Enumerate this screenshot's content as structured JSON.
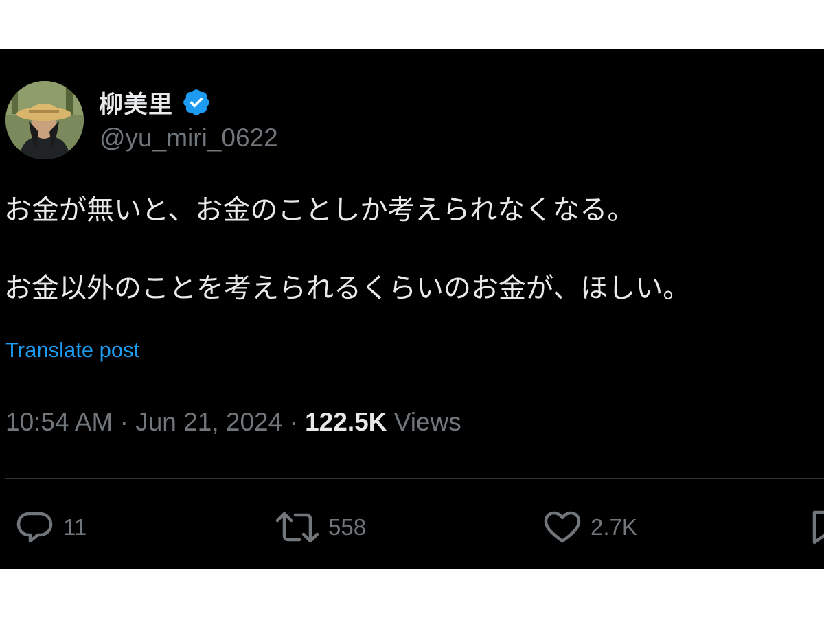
{
  "author": {
    "display_name": "柳美里",
    "handle": "@yu_miri_0622",
    "avatar_icon": "profile-photo-woman-straw-hat",
    "verified_icon": "verified-badge-icon"
  },
  "tweet": {
    "lines": [
      "お金が無いと、お金のことしか考えられなくなる。",
      "お金以外のことを考えられるくらいのお金が、ほしい。"
    ],
    "translate_label": "Translate post"
  },
  "meta": {
    "time": "10:54 AM",
    "separator": " · ",
    "date": "Jun 21, 2024",
    "views_count": "122.5K",
    "views_label": "Views"
  },
  "actions": {
    "replies": "11",
    "reposts": "558",
    "likes": "2.7K"
  },
  "colors": {
    "background": "#000000",
    "text_primary": "#e7e9ea",
    "text_secondary": "#71767b",
    "accent": "#1d9bf0"
  }
}
